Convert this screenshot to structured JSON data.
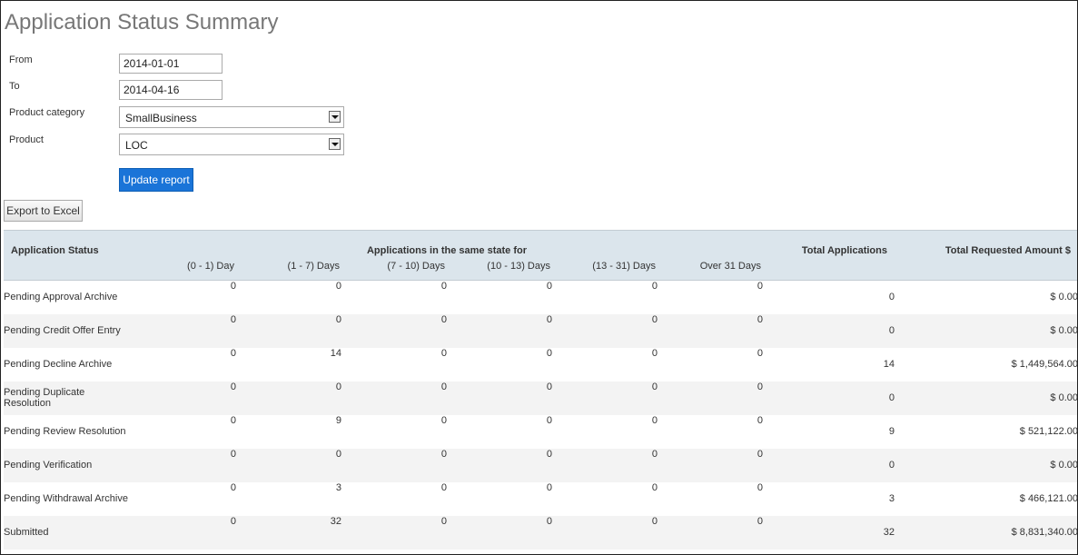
{
  "page": {
    "title": "Application Status Summary"
  },
  "filters": {
    "from": {
      "label": "From",
      "value": "2014-01-01"
    },
    "to": {
      "label": "To",
      "value": "2014-04-16"
    },
    "product_category": {
      "label": "Product category",
      "value": "SmallBusiness"
    },
    "product": {
      "label": "Product",
      "value": "LOC"
    }
  },
  "buttons": {
    "update": "Update report",
    "export": "Export to Excel"
  },
  "table": {
    "headers": {
      "status": "Application Status",
      "group": "Applications in the same state for",
      "buckets": [
        "(0 - 1) Day",
        "(1 - 7) Days",
        "(7 - 10) Days",
        "(10 - 13) Days",
        "(13 - 31) Days",
        "Over 31 Days"
      ],
      "total": "Total Applications",
      "amount": "Total Requested Amount $"
    },
    "rows": [
      {
        "status": "Pending Approval Archive",
        "buckets": [
          "0",
          "0",
          "0",
          "0",
          "0",
          "0"
        ],
        "total": "0",
        "amount": "$ 0.00"
      },
      {
        "status": "Pending Credit Offer Entry",
        "buckets": [
          "0",
          "0",
          "0",
          "0",
          "0",
          "0"
        ],
        "total": "0",
        "amount": "$ 0.00"
      },
      {
        "status": "Pending Decline Archive",
        "buckets": [
          "0",
          "14",
          "0",
          "0",
          "0",
          "0"
        ],
        "total": "14",
        "amount": "$ 1,449,564.00"
      },
      {
        "status": "Pending Duplicate Resolution",
        "buckets": [
          "0",
          "0",
          "0",
          "0",
          "0",
          "0"
        ],
        "total": "0",
        "amount": "$ 0.00"
      },
      {
        "status": "Pending Review Resolution",
        "buckets": [
          "0",
          "9",
          "0",
          "0",
          "0",
          "0"
        ],
        "total": "9",
        "amount": "$ 521,122.00"
      },
      {
        "status": "Pending Verification",
        "buckets": [
          "0",
          "0",
          "0",
          "0",
          "0",
          "0"
        ],
        "total": "0",
        "amount": "$ 0.00"
      },
      {
        "status": "Pending Withdrawal Archive",
        "buckets": [
          "0",
          "3",
          "0",
          "0",
          "0",
          "0"
        ],
        "total": "3",
        "amount": "$ 466,121.00"
      },
      {
        "status": "Submitted",
        "buckets": [
          "0",
          "32",
          "0",
          "0",
          "0",
          "0"
        ],
        "total": "32",
        "amount": "$ 8,831,340.00"
      }
    ]
  }
}
